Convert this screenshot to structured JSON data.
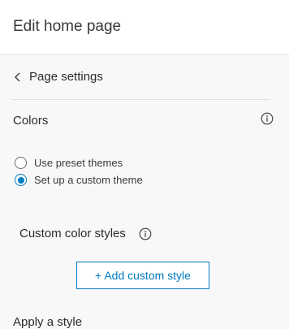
{
  "header": {
    "title": "Edit home page"
  },
  "back": {
    "label": "Page settings",
    "icon": "chevron-left-icon"
  },
  "colors_section": {
    "title": "Colors",
    "info_icon": "info-icon",
    "options": [
      {
        "label": "Use preset themes",
        "checked": false
      },
      {
        "label": "Set up a custom theme",
        "checked": true
      }
    ]
  },
  "custom_styles": {
    "title": "Custom color styles",
    "info_icon": "info-icon",
    "add_button_label": "+ Add custom style"
  },
  "apply_style": {
    "title": "Apply a style"
  },
  "theme": {
    "accent": "#007ac2",
    "background": "#f8f8f8",
    "header_background": "#ffffff"
  }
}
